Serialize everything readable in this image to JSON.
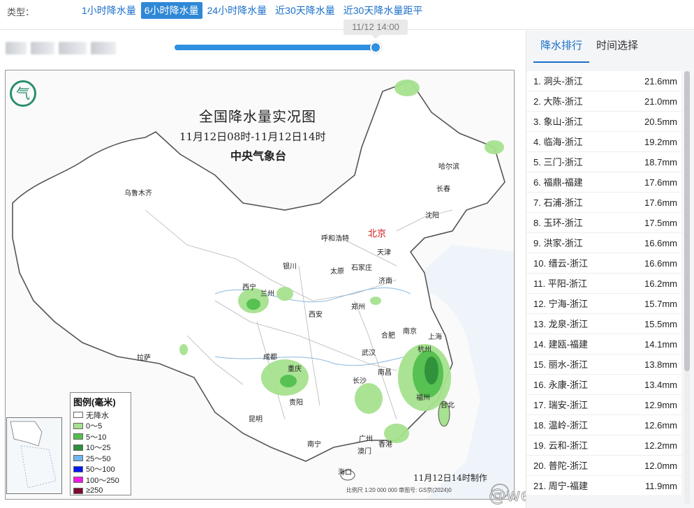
{
  "type_label": "类型：",
  "tabs": [
    {
      "label": "1小时降水量",
      "active": false
    },
    {
      "label": "6小时降水量",
      "active": true
    },
    {
      "label": "24小时降水量",
      "active": false
    },
    {
      "label": "近30天降水量",
      "active": false
    },
    {
      "label": "近30天降水量距平",
      "active": false
    }
  ],
  "slider": {
    "tooltip": "11/12 14:00",
    "progress": 1.0
  },
  "map": {
    "title": "全国降水量实况图",
    "subtitle": "11月12日08时-11月12日14时",
    "organization": "中央气象台",
    "made_time": "11月12日14时制作",
    "scale_text": "比例尺 1:20 000 000   审图号: GS京(2024)0",
    "cities": [
      "乌鲁木齐",
      "哈尔滨",
      "长春",
      "沈阳",
      "北京",
      "天津",
      "呼和浩特",
      "银川",
      "太原",
      "石家庄",
      "济南",
      "西宁",
      "兰州",
      "郑州",
      "西安",
      "南京",
      "合肥",
      "上海",
      "杭州",
      "武汉",
      "成都",
      "拉萨",
      "重庆",
      "南昌",
      "长沙",
      "贵阳",
      "福州",
      "台北",
      "昆明",
      "南宁",
      "广州",
      "澳门",
      "香港",
      "海口"
    ],
    "legend": {
      "title": "图例(毫米)",
      "items": [
        {
          "label": "无降水",
          "color": "#ffffff"
        },
        {
          "label": "0～5",
          "color": "#a6e28f"
        },
        {
          "label": "5～10",
          "color": "#52bf4e"
        },
        {
          "label": "10～25",
          "color": "#2f8f3b"
        },
        {
          "label": "25～50",
          "color": "#6fb6f0"
        },
        {
          "label": "50～100",
          "color": "#0018f0"
        },
        {
          "label": "100～250",
          "color": "#f018e8"
        },
        {
          "label": "≥250",
          "color": "#7d0a2f"
        }
      ]
    }
  },
  "watermark": "@weatherman_倡欣",
  "panel": {
    "tabs": [
      {
        "label": "降水排行",
        "active": true
      },
      {
        "label": "时间选择",
        "active": false
      }
    ],
    "ranking": [
      {
        "name": "1. 洞头-浙江",
        "value": "21.6mm"
      },
      {
        "name": "2. 大陈-浙江",
        "value": "21.0mm"
      },
      {
        "name": "3. 象山-浙江",
        "value": "20.5mm"
      },
      {
        "name": "4. 临海-浙江",
        "value": "19.2mm"
      },
      {
        "name": "5. 三门-浙江",
        "value": "18.7mm"
      },
      {
        "name": "6. 福鼎-福建",
        "value": "17.6mm"
      },
      {
        "name": "7. 石浦-浙江",
        "value": "17.6mm"
      },
      {
        "name": "8. 玉环-浙江",
        "value": "17.5mm"
      },
      {
        "name": "9. 洪家-浙江",
        "value": "16.6mm"
      },
      {
        "name": "10. 缙云-浙江",
        "value": "16.6mm"
      },
      {
        "name": "11. 平阳-浙江",
        "value": "16.2mm"
      },
      {
        "name": "12. 宁海-浙江",
        "value": "15.7mm"
      },
      {
        "name": "13. 龙泉-浙江",
        "value": "15.5mm"
      },
      {
        "name": "14. 建瓯-福建",
        "value": "14.1mm"
      },
      {
        "name": "15. 丽水-浙江",
        "value": "13.8mm"
      },
      {
        "name": "16. 永康-浙江",
        "value": "13.4mm"
      },
      {
        "name": "17. 瑞安-浙江",
        "value": "12.9mm"
      },
      {
        "name": "18. 温岭-浙江",
        "value": "12.6mm"
      },
      {
        "name": "19. 云和-浙江",
        "value": "12.2mm"
      },
      {
        "name": "20. 普陀-浙江",
        "value": "12.0mm"
      },
      {
        "name": "21. 周宁-福建",
        "value": "11.9mm"
      }
    ]
  }
}
